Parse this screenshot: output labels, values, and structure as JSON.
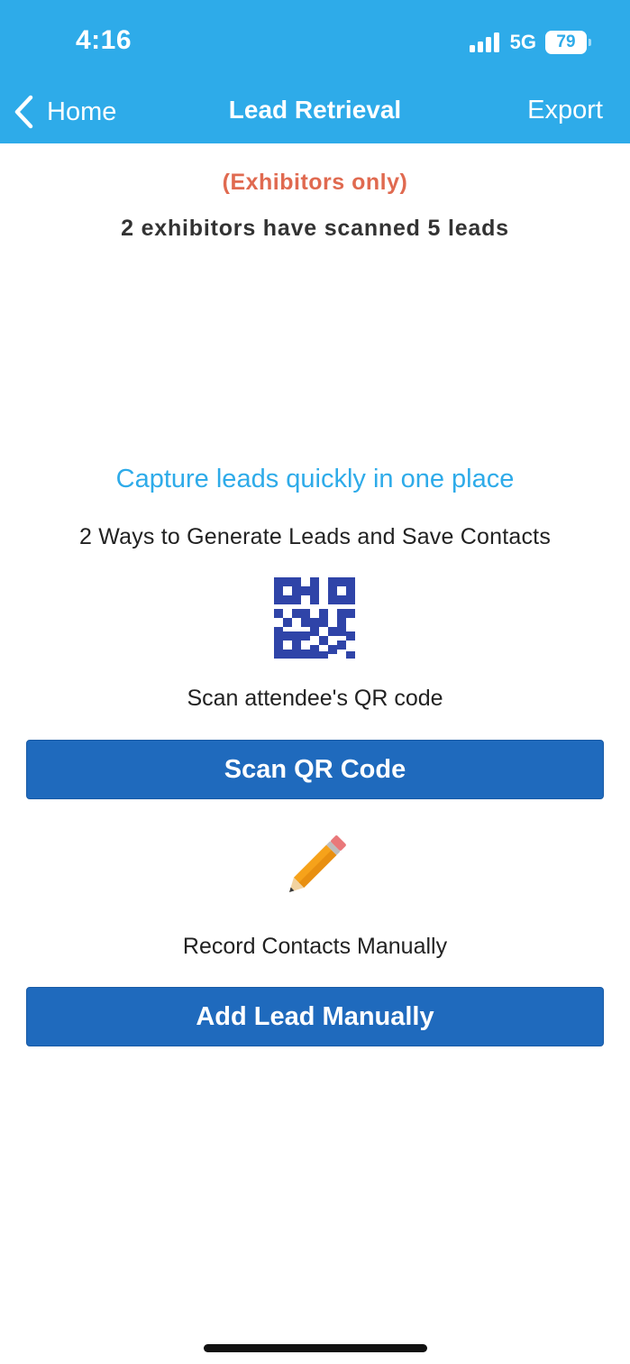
{
  "status_bar": {
    "time": "4:16",
    "network": "5G",
    "battery": "79"
  },
  "nav": {
    "back_label": "Home",
    "title": "Lead Retrieval",
    "export_label": "Export"
  },
  "notice": {
    "exhibitors_only": "(Exhibitors only)",
    "scan_stats": "2 exhibitors have scanned 5 leads"
  },
  "intro": {
    "tagline": "Capture leads quickly in one place",
    "subtitle": "2 Ways to Generate Leads and Save Contacts"
  },
  "qr_section": {
    "icon": "qr-code-icon",
    "caption": "Scan attendee's QR code",
    "button_label": "Scan QR Code"
  },
  "manual_section": {
    "icon": "pencil-icon",
    "caption": "Record Contacts Manually",
    "button_label": "Add Lead Manually"
  },
  "colors": {
    "header_bg": "#2EABE9",
    "button_bg": "#1F6ABD",
    "notice_text": "#E06A50",
    "tagline_text": "#2EABE9",
    "qr_icon": "#2F44A8",
    "pencil_body": "#F6A21A"
  }
}
